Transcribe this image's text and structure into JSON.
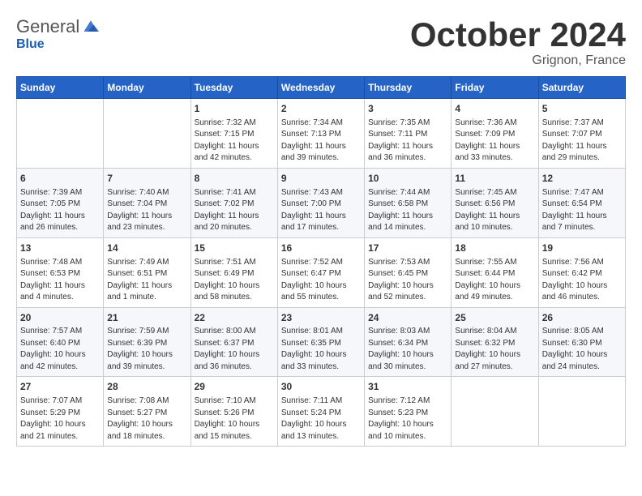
{
  "header": {
    "logo_general": "General",
    "logo_blue": "Blue",
    "month": "October 2024",
    "location": "Grignon, France"
  },
  "days_of_week": [
    "Sunday",
    "Monday",
    "Tuesday",
    "Wednesday",
    "Thursday",
    "Friday",
    "Saturday"
  ],
  "weeks": [
    [
      {
        "day": "",
        "sunrise": "",
        "sunset": "",
        "daylight": ""
      },
      {
        "day": "",
        "sunrise": "",
        "sunset": "",
        "daylight": ""
      },
      {
        "day": "1",
        "sunrise": "Sunrise: 7:32 AM",
        "sunset": "Sunset: 7:15 PM",
        "daylight": "Daylight: 11 hours and 42 minutes."
      },
      {
        "day": "2",
        "sunrise": "Sunrise: 7:34 AM",
        "sunset": "Sunset: 7:13 PM",
        "daylight": "Daylight: 11 hours and 39 minutes."
      },
      {
        "day": "3",
        "sunrise": "Sunrise: 7:35 AM",
        "sunset": "Sunset: 7:11 PM",
        "daylight": "Daylight: 11 hours and 36 minutes."
      },
      {
        "day": "4",
        "sunrise": "Sunrise: 7:36 AM",
        "sunset": "Sunset: 7:09 PM",
        "daylight": "Daylight: 11 hours and 33 minutes."
      },
      {
        "day": "5",
        "sunrise": "Sunrise: 7:37 AM",
        "sunset": "Sunset: 7:07 PM",
        "daylight": "Daylight: 11 hours and 29 minutes."
      }
    ],
    [
      {
        "day": "6",
        "sunrise": "Sunrise: 7:39 AM",
        "sunset": "Sunset: 7:05 PM",
        "daylight": "Daylight: 11 hours and 26 minutes."
      },
      {
        "day": "7",
        "sunrise": "Sunrise: 7:40 AM",
        "sunset": "Sunset: 7:04 PM",
        "daylight": "Daylight: 11 hours and 23 minutes."
      },
      {
        "day": "8",
        "sunrise": "Sunrise: 7:41 AM",
        "sunset": "Sunset: 7:02 PM",
        "daylight": "Daylight: 11 hours and 20 minutes."
      },
      {
        "day": "9",
        "sunrise": "Sunrise: 7:43 AM",
        "sunset": "Sunset: 7:00 PM",
        "daylight": "Daylight: 11 hours and 17 minutes."
      },
      {
        "day": "10",
        "sunrise": "Sunrise: 7:44 AM",
        "sunset": "Sunset: 6:58 PM",
        "daylight": "Daylight: 11 hours and 14 minutes."
      },
      {
        "day": "11",
        "sunrise": "Sunrise: 7:45 AM",
        "sunset": "Sunset: 6:56 PM",
        "daylight": "Daylight: 11 hours and 10 minutes."
      },
      {
        "day": "12",
        "sunrise": "Sunrise: 7:47 AM",
        "sunset": "Sunset: 6:54 PM",
        "daylight": "Daylight: 11 hours and 7 minutes."
      }
    ],
    [
      {
        "day": "13",
        "sunrise": "Sunrise: 7:48 AM",
        "sunset": "Sunset: 6:53 PM",
        "daylight": "Daylight: 11 hours and 4 minutes."
      },
      {
        "day": "14",
        "sunrise": "Sunrise: 7:49 AM",
        "sunset": "Sunset: 6:51 PM",
        "daylight": "Daylight: 11 hours and 1 minute."
      },
      {
        "day": "15",
        "sunrise": "Sunrise: 7:51 AM",
        "sunset": "Sunset: 6:49 PM",
        "daylight": "Daylight: 10 hours and 58 minutes."
      },
      {
        "day": "16",
        "sunrise": "Sunrise: 7:52 AM",
        "sunset": "Sunset: 6:47 PM",
        "daylight": "Daylight: 10 hours and 55 minutes."
      },
      {
        "day": "17",
        "sunrise": "Sunrise: 7:53 AM",
        "sunset": "Sunset: 6:45 PM",
        "daylight": "Daylight: 10 hours and 52 minutes."
      },
      {
        "day": "18",
        "sunrise": "Sunrise: 7:55 AM",
        "sunset": "Sunset: 6:44 PM",
        "daylight": "Daylight: 10 hours and 49 minutes."
      },
      {
        "day": "19",
        "sunrise": "Sunrise: 7:56 AM",
        "sunset": "Sunset: 6:42 PM",
        "daylight": "Daylight: 10 hours and 46 minutes."
      }
    ],
    [
      {
        "day": "20",
        "sunrise": "Sunrise: 7:57 AM",
        "sunset": "Sunset: 6:40 PM",
        "daylight": "Daylight: 10 hours and 42 minutes."
      },
      {
        "day": "21",
        "sunrise": "Sunrise: 7:59 AM",
        "sunset": "Sunset: 6:39 PM",
        "daylight": "Daylight: 10 hours and 39 minutes."
      },
      {
        "day": "22",
        "sunrise": "Sunrise: 8:00 AM",
        "sunset": "Sunset: 6:37 PM",
        "daylight": "Daylight: 10 hours and 36 minutes."
      },
      {
        "day": "23",
        "sunrise": "Sunrise: 8:01 AM",
        "sunset": "Sunset: 6:35 PM",
        "daylight": "Daylight: 10 hours and 33 minutes."
      },
      {
        "day": "24",
        "sunrise": "Sunrise: 8:03 AM",
        "sunset": "Sunset: 6:34 PM",
        "daylight": "Daylight: 10 hours and 30 minutes."
      },
      {
        "day": "25",
        "sunrise": "Sunrise: 8:04 AM",
        "sunset": "Sunset: 6:32 PM",
        "daylight": "Daylight: 10 hours and 27 minutes."
      },
      {
        "day": "26",
        "sunrise": "Sunrise: 8:05 AM",
        "sunset": "Sunset: 6:30 PM",
        "daylight": "Daylight: 10 hours and 24 minutes."
      }
    ],
    [
      {
        "day": "27",
        "sunrise": "Sunrise: 7:07 AM",
        "sunset": "Sunset: 5:29 PM",
        "daylight": "Daylight: 10 hours and 21 minutes."
      },
      {
        "day": "28",
        "sunrise": "Sunrise: 7:08 AM",
        "sunset": "Sunset: 5:27 PM",
        "daylight": "Daylight: 10 hours and 18 minutes."
      },
      {
        "day": "29",
        "sunrise": "Sunrise: 7:10 AM",
        "sunset": "Sunset: 5:26 PM",
        "daylight": "Daylight: 10 hours and 15 minutes."
      },
      {
        "day": "30",
        "sunrise": "Sunrise: 7:11 AM",
        "sunset": "Sunset: 5:24 PM",
        "daylight": "Daylight: 10 hours and 13 minutes."
      },
      {
        "day": "31",
        "sunrise": "Sunrise: 7:12 AM",
        "sunset": "Sunset: 5:23 PM",
        "daylight": "Daylight: 10 hours and 10 minutes."
      },
      {
        "day": "",
        "sunrise": "",
        "sunset": "",
        "daylight": ""
      },
      {
        "day": "",
        "sunrise": "",
        "sunset": "",
        "daylight": ""
      }
    ]
  ]
}
